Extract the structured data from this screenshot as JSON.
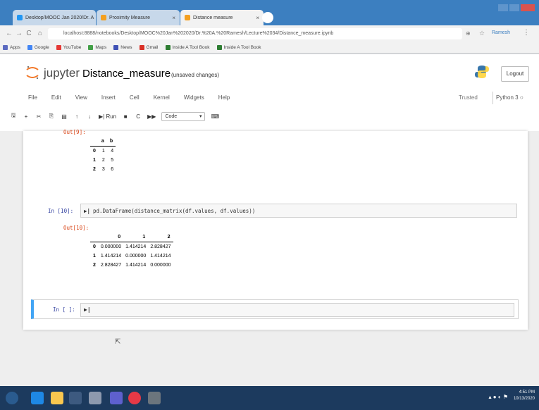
{
  "browser": {
    "tabs": [
      {
        "label": "Desktop/MOOC Jan 2020/Dr. A",
        "color": "#2196f3",
        "active": false
      },
      {
        "label": "Proximity Measure",
        "color": "#f4a020",
        "active": false
      },
      {
        "label": "Distance measure",
        "color": "#f4a020",
        "active": true
      }
    ],
    "url": "localhost:8888/notebooks/Desktop/MOOC%20Jan%202020/Dr.%20A.%20Ramesh/Lecture%2034/Distance_measure.ipynb",
    "bookmarks": [
      {
        "label": "Apps",
        "color": "#5c6bc0"
      },
      {
        "label": "Google",
        "color": "#4285f4"
      },
      {
        "label": "YouTube",
        "color": "#e53935"
      },
      {
        "label": "Maps",
        "color": "#43a047"
      },
      {
        "label": "News",
        "color": "#3f51b5"
      },
      {
        "label": "Gmail",
        "color": "#d93025"
      },
      {
        "label": "Inside A Tool Book",
        "color": "#2e7d32"
      },
      {
        "label": "Inside A Tool Book",
        "color": "#2e7d32"
      }
    ],
    "profile": "Ramesh"
  },
  "jupyter": {
    "brand": "jupyter",
    "notebook_name": "Distance_measure",
    "status": "(unsaved changes)",
    "logout": "Logout",
    "menu": [
      "File",
      "Edit",
      "View",
      "Insert",
      "Cell",
      "Kernel",
      "Widgets",
      "Help"
    ],
    "trusted": "Trusted",
    "kernel": "Python 3",
    "toolbar": {
      "run": "Run",
      "celltype": "Code"
    }
  },
  "cells": {
    "out9_prompt": "Out[9]:",
    "table1": {
      "columns": [
        "a",
        "b"
      ],
      "rows": [
        [
          "0",
          "1",
          "4"
        ],
        [
          "1",
          "2",
          "5"
        ],
        [
          "2",
          "3",
          "6"
        ]
      ]
    },
    "in19_prompt": "In [10]:",
    "in19_code": "pd.DataFrame(distance_matrix(df.values, df.values))",
    "out19_prompt": "Out[10]:",
    "table2": {
      "columns": [
        "0",
        "1",
        "2"
      ],
      "rows": [
        [
          "0",
          "0.000000",
          "1.414214",
          "2.828427"
        ],
        [
          "1",
          "1.414214",
          "0.000000",
          "1.414214"
        ],
        [
          "2",
          "2.828427",
          "1.414214",
          "0.000000"
        ]
      ]
    },
    "in20_prompt": "In [ ]:"
  },
  "taskbar": {
    "time": "4:51 PM",
    "date": "10/13/2020"
  }
}
